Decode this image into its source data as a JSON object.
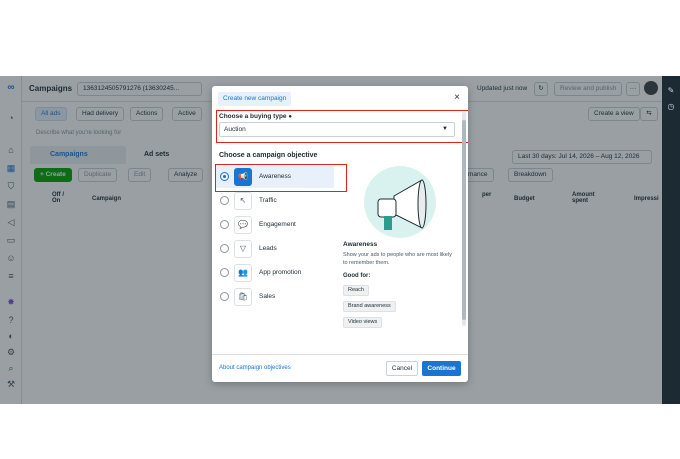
{
  "app": {
    "title": "Campaigns",
    "account": "1363124505791276 (13630245...",
    "updated": "Updated just now",
    "review_button": "Review and publish"
  },
  "toolbar": {
    "tabs": [
      "All ads",
      "Had delivery",
      "Actions",
      "Active"
    ],
    "search_placeholder": "Describe what you're looking for",
    "create_view": "Create a view",
    "levels": [
      "Campaigns",
      "Ad sets"
    ],
    "date_range": "Last 30 days: Jul 14, 2026 – Aug 12, 2026",
    "actions": [
      "+ Create",
      "Duplicate",
      "Edit",
      "Analyze"
    ],
    "right_actions": [
      "mance",
      "Breakdown"
    ],
    "columns": [
      "Off / On",
      "Campaign",
      "Budget",
      "Amount spent",
      "Impressi",
      "per"
    ]
  },
  "modal": {
    "title": "Create new campaign",
    "buying_type_label": "Choose a buying type",
    "buying_type_value": "Auction",
    "objective_heading": "Choose a campaign objective",
    "options": [
      {
        "label": "Awareness",
        "icon": "megaphone-icon",
        "glyph": "📢",
        "selected": true
      },
      {
        "label": "Traffic",
        "icon": "cursor-icon",
        "glyph": "↖",
        "selected": false
      },
      {
        "label": "Engagement",
        "icon": "chat-icon",
        "glyph": "💬",
        "selected": false
      },
      {
        "label": "Leads",
        "icon": "funnel-icon",
        "glyph": "▽",
        "selected": false
      },
      {
        "label": "App promotion",
        "icon": "people-icon",
        "glyph": "👥",
        "selected": false
      },
      {
        "label": "Sales",
        "icon": "shopping-bag-icon",
        "glyph": "🛍",
        "selected": false
      }
    ],
    "desc_title": "Awareness",
    "desc_text": "Show your ads to people who are most likely to remember them.",
    "good_for_label": "Good for:",
    "good_for": [
      "Reach",
      "Brand awareness",
      "Video views"
    ],
    "about_link": "About campaign objectives",
    "cancel": "Cancel",
    "continue": "Continue"
  },
  "colors": {
    "accent": "#1876d2",
    "highlight": "#e2231a",
    "illustration": "#2a9d8f"
  }
}
